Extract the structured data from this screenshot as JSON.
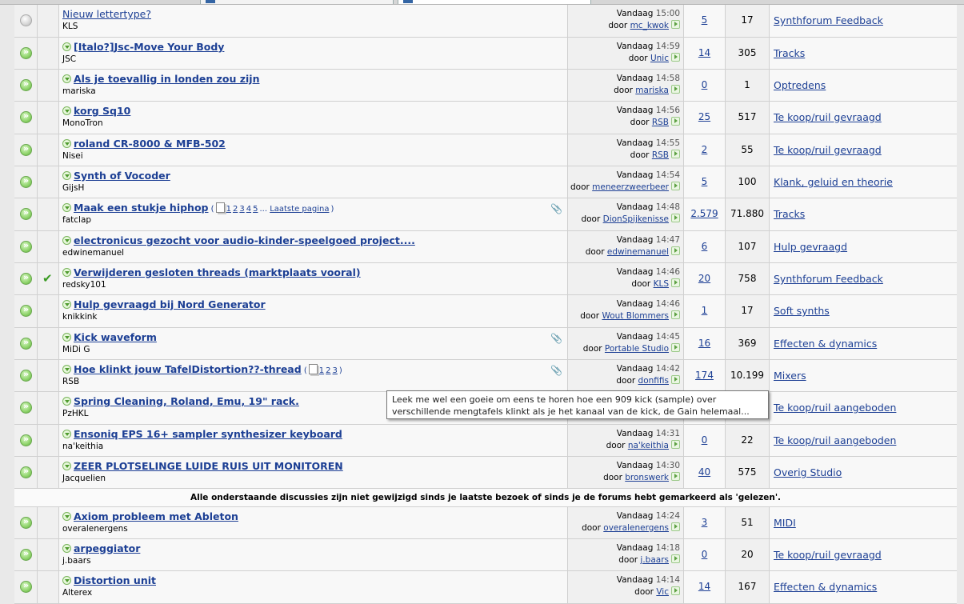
{
  "threads_new": [
    {
      "icon": "grey",
      "mark": "",
      "title": "Nieuw lettertype?",
      "title_style": "plain",
      "author": "KLS",
      "pages": [],
      "attach": false,
      "date": "Vandaag",
      "time": "15:00",
      "by_label": "door",
      "by": "mc_kwok",
      "replies": "5",
      "views": "17",
      "forum": "Synthforum Feedback"
    },
    {
      "icon": "green",
      "mark": "",
      "title": "[Italo?]Jsc-Move Your Body",
      "author": "JSC",
      "pages": [],
      "attach": false,
      "date": "Vandaag",
      "time": "14:59",
      "by_label": "door",
      "by": "Unic",
      "replies": "14",
      "views": "305",
      "forum": "Tracks"
    },
    {
      "icon": "green",
      "mark": "",
      "title": "Als je toevallig in londen zou zijn",
      "author": "mariska",
      "pages": [],
      "attach": false,
      "date": "Vandaag",
      "time": "14:58",
      "by_label": "door",
      "by": "mariska",
      "replies": "0",
      "views": "1",
      "forum": "Optredens"
    },
    {
      "icon": "green",
      "mark": "",
      "title": "korg Sq10",
      "author": "MonoTron",
      "pages": [],
      "attach": false,
      "date": "Vandaag",
      "time": "14:56",
      "by_label": "door",
      "by": "RSB",
      "replies": "25",
      "views": "517",
      "forum": "Te koop/ruil gevraagd"
    },
    {
      "icon": "green",
      "mark": "",
      "title": "roland CR-8000 & MFB-502",
      "author": "Nisei",
      "pages": [],
      "attach": false,
      "date": "Vandaag",
      "time": "14:55",
      "by_label": "door",
      "by": "RSB",
      "replies": "2",
      "views": "55",
      "forum": "Te koop/ruil gevraagd"
    },
    {
      "icon": "green",
      "mark": "",
      "title": "Synth of Vocoder",
      "author": "GijsH",
      "pages": [],
      "attach": false,
      "date": "Vandaag",
      "time": "14:54",
      "by_label": "door",
      "by": "meneerzweerbeer",
      "replies": "5",
      "views": "100",
      "forum": "Klank, geluid en theorie"
    },
    {
      "icon": "green",
      "mark": "",
      "title": "Maak een stukje hiphop",
      "author": "fatclap",
      "pages": [
        "1",
        "2",
        "3",
        "4",
        "5"
      ],
      "pages_more": "...",
      "last_page": "Laatste pagina",
      "attach": true,
      "date": "Vandaag",
      "time": "14:48",
      "by_label": "door",
      "by": "DionSpijkenisse",
      "replies": "2.579",
      "views": "71.880",
      "forum": "Tracks"
    },
    {
      "icon": "green",
      "mark": "",
      "title": "electronicus gezocht voor audio-kinder-speelgoed project....",
      "author": "edwinemanuel",
      "pages": [],
      "attach": false,
      "date": "Vandaag",
      "time": "14:47",
      "by_label": "door",
      "by": "edwinemanuel",
      "replies": "6",
      "views": "107",
      "forum": "Hulp gevraagd"
    },
    {
      "icon": "green",
      "mark": "check",
      "title": "Verwijderen gesloten threads (marktplaats vooral)",
      "author": "redsky101",
      "pages": [],
      "attach": false,
      "date": "Vandaag",
      "time": "14:46",
      "by_label": "door",
      "by": "KLS",
      "replies": "20",
      "views": "758",
      "forum": "Synthforum Feedback"
    },
    {
      "icon": "green",
      "mark": "",
      "title": "Hulp gevraagd bij Nord Generator",
      "author": "knikkink",
      "pages": [],
      "attach": false,
      "date": "Vandaag",
      "time": "14:46",
      "by_label": "door",
      "by": "Wout Blommers",
      "replies": "1",
      "views": "17",
      "forum": "Soft synths"
    },
    {
      "icon": "green",
      "mark": "",
      "title": "Kick waveform",
      "author": "MiDi G",
      "pages": [],
      "attach": true,
      "date": "Vandaag",
      "time": "14:45",
      "by_label": "door",
      "by": "Portable Studio",
      "replies": "16",
      "views": "369",
      "forum": "Effecten & dynamics"
    },
    {
      "icon": "green",
      "mark": "",
      "title": "Hoe klinkt jouw TafelDistortion??-thread",
      "author": "RSB",
      "pages": [
        "1",
        "2",
        "3"
      ],
      "attach": true,
      "date": "Vandaag",
      "time": "14:42",
      "by_label": "door",
      "by": "donfifis",
      "replies": "174",
      "views": "10.199",
      "forum": "Mixers"
    },
    {
      "icon": "green",
      "mark": "",
      "title": "Spring Cleaning, Roland, Emu, 19\" rack.",
      "author": "PzHKL",
      "pages": [],
      "attach": false,
      "date": "",
      "time": "",
      "by_label": "",
      "by": "",
      "replies": "",
      "views": "",
      "forum": "Te koop/ruil aangeboden"
    },
    {
      "icon": "green",
      "mark": "",
      "title": "Ensoniq EPS 16+ sampler synthesizer keyboard",
      "author": "na'keithia",
      "pages": [],
      "attach": false,
      "date": "Vandaag",
      "time": "14:31",
      "by_label": "door",
      "by": "na'keithia",
      "replies": "0",
      "views": "22",
      "forum": "Te koop/ruil aangeboden"
    },
    {
      "icon": "green",
      "mark": "",
      "title": "ZEER PLOTSELINGE LUIDE RUIS UIT MONITOREN",
      "author": "Jacquelien",
      "pages": [],
      "attach": false,
      "date": "Vandaag",
      "time": "14:30",
      "by_label": "door",
      "by": "bronswerk",
      "replies": "40",
      "views": "575",
      "forum": "Overig Studio"
    }
  ],
  "separator_text": "Alle onderstaande discussies zijn niet gewijzigd sinds je laatste bezoek of sinds je de forums hebt gemarkeerd als 'gelezen'.",
  "threads_old": [
    {
      "icon": "green",
      "mark": "",
      "title": "Axiom probleem met Ableton",
      "author": "overalenergens",
      "pages": [],
      "attach": false,
      "date": "Vandaag",
      "time": "14:24",
      "by_label": "door",
      "by": "overalenergens",
      "replies": "3",
      "views": "51",
      "forum": "MIDI"
    },
    {
      "icon": "green",
      "mark": "",
      "title": "arpeggiator",
      "author": "j.baars",
      "pages": [],
      "attach": false,
      "date": "Vandaag",
      "time": "14:18",
      "by_label": "door",
      "by": "j.baars",
      "replies": "0",
      "views": "20",
      "forum": "Te koop/ruil gevraagd"
    },
    {
      "icon": "green",
      "mark": "",
      "title": "Distortion unit",
      "author": "Alterex",
      "pages": [],
      "attach": false,
      "date": "Vandaag",
      "time": "14:14",
      "by_label": "door",
      "by": "Vic",
      "replies": "14",
      "views": "167",
      "forum": "Effecten & dynamics"
    }
  ],
  "tooltip": "Leek me wel een goeie om eens te horen hoe een 909 kick (sample) over verschillende mengtafels klinkt als je het kanaal van de kick, de Gain helemaal..."
}
